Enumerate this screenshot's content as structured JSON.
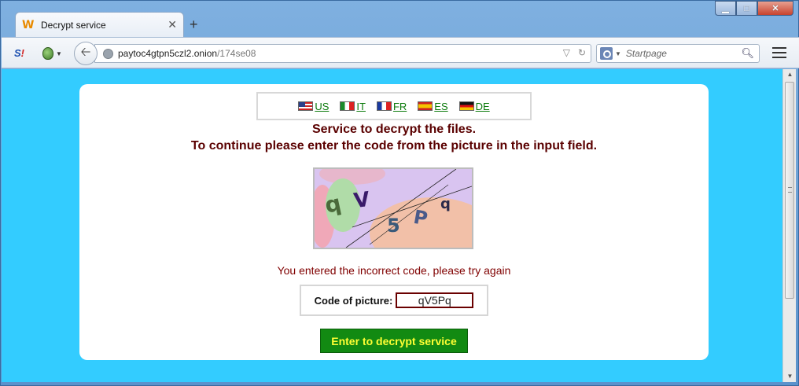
{
  "browser": {
    "tab_title": "Decrypt service",
    "tab_favicon": "W",
    "newtab": "+",
    "url_host": "paytoc4gtpn5czl2.onion",
    "url_path": "/174se08",
    "search_placeholder": "Startpage",
    "ext1_label_a": "S",
    "ext1_label_b": "!",
    "icons": [
      "tab-favicon-icon",
      "close-icon",
      "new-tab-icon",
      "minimize-icon",
      "maximize-icon",
      "close-window-icon",
      "back-icon",
      "globe-icon",
      "bookmark-star-icon",
      "reload-icon",
      "search-icon",
      "menu-icon",
      "onion-icon"
    ]
  },
  "page": {
    "languages": [
      {
        "code": "US",
        "flag": "us"
      },
      {
        "code": "IT",
        "flag": "it"
      },
      {
        "code": "FR",
        "flag": "fr"
      },
      {
        "code": "ES",
        "flag": "es"
      },
      {
        "code": "DE",
        "flag": "de"
      }
    ],
    "headline_line1": "Service to decrypt the files.",
    "headline_line2": "To continue please enter the code from the picture in the input field.",
    "captcha_chars": [
      "q",
      "V",
      "5",
      "P",
      "q"
    ],
    "error_message": "You entered the incorrect code, please try again",
    "code_label": "Code of picture:",
    "code_value": "qV5Pq",
    "submit_label": "Enter to decrypt service"
  },
  "colors": {
    "background": "#33ccff",
    "headline": "#5a0000",
    "error": "#800000",
    "button_bg": "#128a12",
    "button_text": "#ffff33",
    "link": "#0a7a0a"
  }
}
